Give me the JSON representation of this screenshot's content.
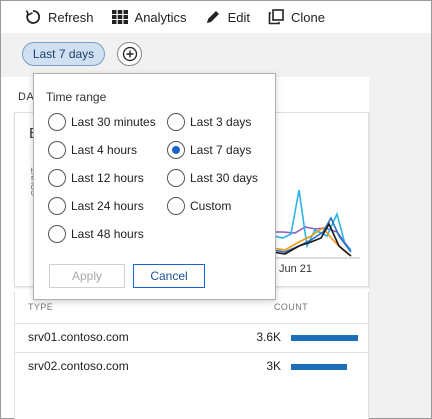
{
  "toolbar": {
    "refresh": "Refresh",
    "analytics": "Analytics",
    "edit": "Edit",
    "clone": "Clone",
    "icons": [
      "refresh-icon",
      "grid-icon",
      "pencil-icon",
      "clone-icon"
    ]
  },
  "filter": {
    "active_pill": "Last 7 days",
    "add_icon": "plus-circle-icon"
  },
  "background": {
    "section_title": "DA",
    "tile_letter": "E",
    "tile_axis_label": "COUNT",
    "x_tick": "Jun 21",
    "table": {
      "headers": [
        "TYPE",
        "COUNT"
      ],
      "rows": [
        {
          "name": "srv01.contoso.com",
          "count": "3.6K",
          "fraction": 1.0
        },
        {
          "name": "srv02.contoso.com",
          "count": "3K",
          "fraction": 0.83
        }
      ]
    }
  },
  "popup": {
    "title": "Time range",
    "left_options": [
      "Last 30 minutes",
      "Last 4 hours",
      "Last 12 hours",
      "Last 24 hours",
      "Last 48 hours"
    ],
    "right_options": [
      "Last 3 days",
      "Last 7 days",
      "Last 30 days",
      "Custom"
    ],
    "selected": "Last 7 days",
    "apply": "Apply",
    "cancel": "Cancel"
  },
  "colors": {
    "accent": "#1b64c7",
    "pill_bg": "#cfe0f3",
    "bar": "#1d6fb8",
    "series": [
      "#1a1a1a",
      "#2cb5e8",
      "#f39c12",
      "#8e5fbf",
      "#2b6fbf"
    ]
  }
}
